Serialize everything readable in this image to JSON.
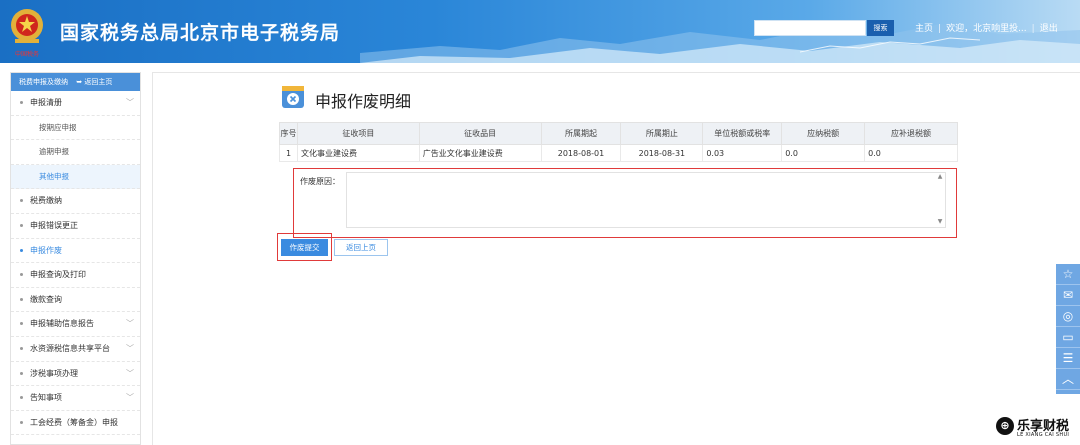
{
  "header": {
    "title": "国家税务总局北京市电子税务局",
    "emblem_subtitle": "中国税务",
    "search_placeholder": "",
    "search_label": "搜索",
    "home_link": "主页",
    "welcome": "欢迎，北京响里投...",
    "logout": "退出"
  },
  "sidebar": {
    "title": "税费申报及缴纳",
    "back_home": "返回主页",
    "items": [
      {
        "label": "申报清册",
        "has_sub": true
      },
      {
        "label": "按期应申报",
        "sub": true
      },
      {
        "label": "逾期申报",
        "sub": true
      },
      {
        "label": "其他申报",
        "sub": true,
        "active": true
      },
      {
        "label": "税费缴纳"
      },
      {
        "label": "申报错误更正"
      },
      {
        "label": "申报作废",
        "active": true
      },
      {
        "label": "申报查询及打印"
      },
      {
        "label": "缴款查询"
      },
      {
        "label": "申报辅助信息报告",
        "has_sub": true
      },
      {
        "label": "水资源税信息共享平台",
        "has_sub": true
      },
      {
        "label": "涉税事项办理",
        "has_sub": true
      },
      {
        "label": "告知事项",
        "has_sub": true
      },
      {
        "label": "工会经费（筹备金）申报"
      }
    ]
  },
  "main": {
    "page_title": "申报作废明细",
    "table": {
      "headers": [
        "序号",
        "征收项目",
        "征收品目",
        "所属期起",
        "所属期止",
        "单位税额或税率",
        "应纳税额",
        "应补退税额"
      ],
      "rows": [
        [
          "1",
          "文化事业建设费",
          "广告业文化事业建设费",
          "2018-08-01",
          "2018-08-31",
          "0.03",
          "0.0",
          "0.0"
        ]
      ]
    },
    "reason_label": "作废原因：",
    "reason_value": "",
    "submit_label": "作废提交",
    "back_label": "返回上页"
  },
  "watermark": {
    "cn": "乐享财税",
    "en": "LE XIANG CAI SHUI"
  },
  "colors": {
    "accent": "#3a8be0",
    "header": "#1a6fc4",
    "highlight": "#e03a3a"
  }
}
